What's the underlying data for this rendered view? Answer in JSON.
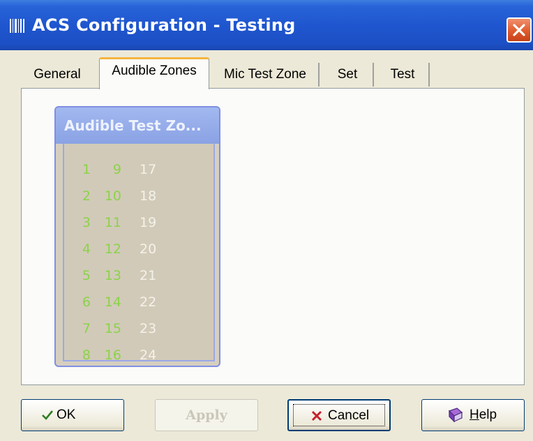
{
  "window": {
    "title": "ACS Configuration - Testing",
    "app_icon": "barcode-app-icon",
    "close_icon": "close-icon"
  },
  "tabs": [
    {
      "label": "General",
      "active": false
    },
    {
      "label": "Audible Zones",
      "active": true
    },
    {
      "label": "Mic Test Zone",
      "active": false
    },
    {
      "label": "Set",
      "active": false
    },
    {
      "label": "Test",
      "active": false
    }
  ],
  "audible_group": {
    "title": "Audible Test Zo...",
    "columns": [
      {
        "zones": [
          "1",
          "2",
          "3",
          "4",
          "5",
          "6",
          "7",
          "8"
        ],
        "color": "#8cd24a"
      },
      {
        "zones": [
          "9",
          "10",
          "11",
          "12",
          "13",
          "14",
          "15",
          "16"
        ],
        "color": "#8cd24a"
      },
      {
        "zones": [
          "17",
          "18",
          "19",
          "20",
          "21",
          "22",
          "23",
          "24"
        ],
        "color": "#f4f2ea"
      }
    ]
  },
  "buttons": {
    "ok": {
      "label": "OK",
      "icon": "check-icon"
    },
    "apply": {
      "label": "Apply",
      "enabled": false
    },
    "cancel": {
      "label": "Cancel",
      "icon": "x-icon"
    },
    "help": {
      "label": "Help",
      "accelerator": "H",
      "rest": "elp",
      "icon": "help-book-icon"
    }
  },
  "colors": {
    "titlebar": "#1f56cf",
    "active_tab_accent": "#f5b53f",
    "group_header": "#8aa2e4",
    "zone_green": "#8cd24a"
  }
}
